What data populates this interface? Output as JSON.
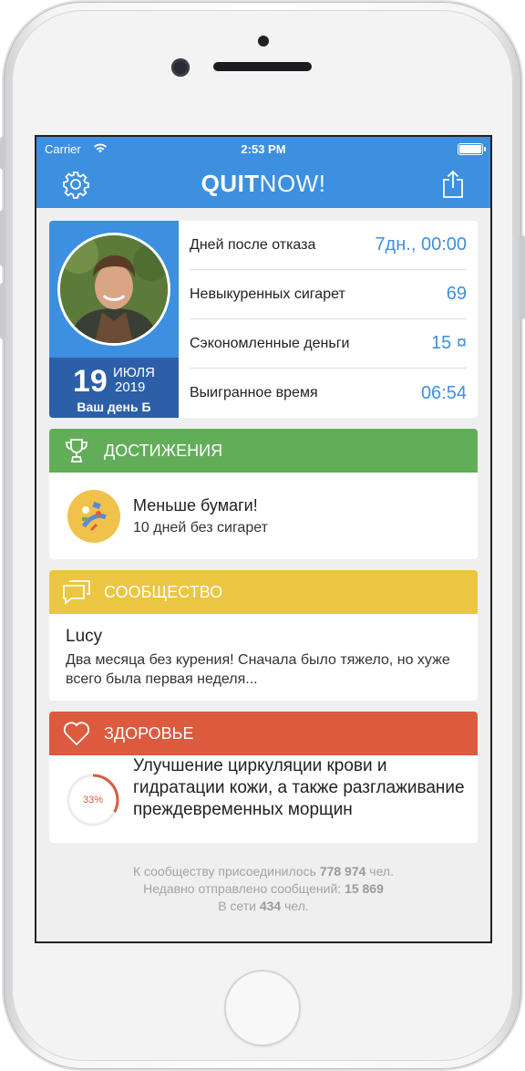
{
  "status_bar": {
    "carrier": "Carrier",
    "time": "2:53 PM"
  },
  "nav": {
    "brand_bold": "QUIT",
    "brand_light": "NOW!",
    "settings_icon": "gear-icon",
    "share_icon": "share-icon"
  },
  "profile": {
    "date_day": "19",
    "date_month": "ИЮЛЯ",
    "date_year": "2019",
    "date_caption": "Ваш день Б"
  },
  "stats": [
    {
      "label": "Дней после отказа",
      "value": "7дн., 00:00"
    },
    {
      "label": "Невыкуренных сигарет",
      "value": "69"
    },
    {
      "label": "Сэкономленные деньги",
      "value": "15 ¤"
    },
    {
      "label": "Выигранное время",
      "value": "06:54"
    }
  ],
  "achievements": {
    "header": "ДОСТИЖЕНИЯ",
    "title": "Меньше бумаги!",
    "subtitle": "10 дней без сигарет"
  },
  "community": {
    "header": "СООБЩЕСТВО",
    "author": "Lucy",
    "message": "Два месяца без курения! Сначала было тяжело, но хуже всего была первая неделя..."
  },
  "health": {
    "header": "ЗДОРОВЬЕ",
    "progress": 0.33,
    "progress_label": "33%",
    "text": "Улучшение циркуляции крови и гидратации кожи, а также разглаживание преждевременных морщин"
  },
  "footer": {
    "line1_prefix": "К сообществу присоединилось ",
    "line1_value": "778 974",
    "line1_suffix": " чел.",
    "line2_prefix": "Недавно отправлено сообщений: ",
    "line2_value": "15 869",
    "line3_prefix": "В сети ",
    "line3_value": "434",
    "line3_suffix": " чел."
  },
  "colors": {
    "primary": "#3d8fe0",
    "achievements": "#62ad58",
    "community": "#ebc642",
    "health": "#dc5a3e"
  }
}
